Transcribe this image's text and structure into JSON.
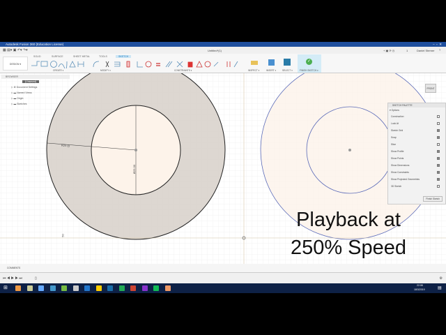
{
  "window": {
    "title": "Autodesk Fusion 360 (Education License)",
    "doc_tab": "Untitled*(1)",
    "user": "Daniel Sterner",
    "jobs": "1"
  },
  "ribbon": {
    "workspace": "DESIGN ▾",
    "tabs": [
      "SOLID",
      "SURFACE",
      "SHEET METAL",
      "TOOLS",
      "SKETCH"
    ],
    "active_tab": "SKETCH",
    "groups": [
      "CREATE ▾",
      "MODIFY ▾",
      "CONSTRAINTS ▾",
      "INSPECT ▾",
      "INSERT ▾",
      "SELECT ▾",
      "FINISH SKETCH ▾"
    ]
  },
  "browser": {
    "title": "BROWSER",
    "root": "(Unsaved)",
    "items": [
      "Document Settings",
      "Named Views",
      "Origin",
      "Sketches"
    ]
  },
  "viewcube": {
    "face": "FRONT"
  },
  "dimensions": {
    "radius": "R25 (i)",
    "diameter": "Ø25.00",
    "axis_label": "50"
  },
  "palette": {
    "title": "SKETCH PALETTE",
    "section": "Options",
    "rows": [
      "Construction",
      "Look At",
      "Sketch Grid",
      "Snap",
      "Slice",
      "Show Profile",
      "Show Points",
      "Show Dimensions",
      "Show Constraints",
      "Show Projected Geometries",
      "3D Sketch"
    ],
    "checked": [
      false,
      false,
      true,
      true,
      false,
      true,
      true,
      true,
      true,
      true,
      false
    ],
    "finish": "Finish Sketch"
  },
  "comments": {
    "label": "COMMENTS"
  },
  "overlay": {
    "line1": "Playback at",
    "line2": "250% Speed"
  },
  "taskbar": {
    "time": "22:08",
    "date": "18/3/2019"
  },
  "colors": {
    "accent": "#1f4f9e",
    "profile": "#d9d3cc",
    "inner": "#fdf3ea",
    "finish": "#4caf50"
  }
}
